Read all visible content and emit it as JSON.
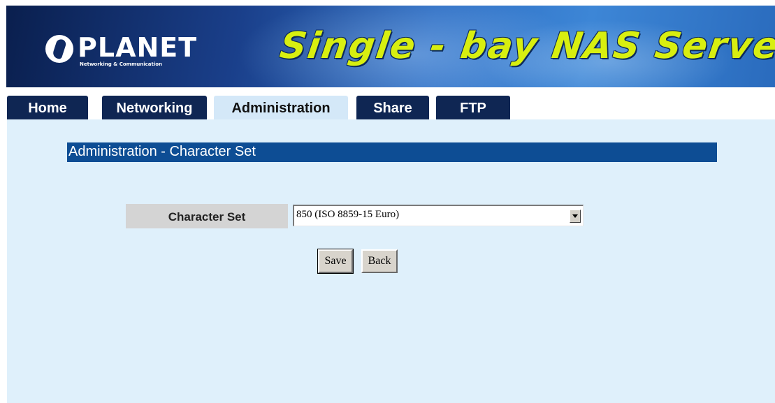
{
  "banner": {
    "logo_text": "PLANET",
    "logo_subtitle": "Networking & Communication",
    "product_title": "Single - bay NAS Server"
  },
  "tabs": [
    {
      "label": "Home",
      "active": false
    },
    {
      "label": "Networking",
      "active": false
    },
    {
      "label": "Administration",
      "active": true
    },
    {
      "label": "Share",
      "active": false
    },
    {
      "label": "FTP",
      "active": false
    }
  ],
  "section": {
    "title": "Administration - Character Set"
  },
  "form": {
    "character_set_label": "Character Set",
    "character_set_value": "850 (ISO 8859-15 Euro)"
  },
  "buttons": {
    "save_label": "Save",
    "back_label": "Back"
  },
  "colors": {
    "tab_dark": "#0f2653",
    "tab_active": "#d4e8f8",
    "content_bg": "#dff0fb",
    "section_bar": "#0d4d94",
    "title_yellow": "#d8ef10"
  }
}
